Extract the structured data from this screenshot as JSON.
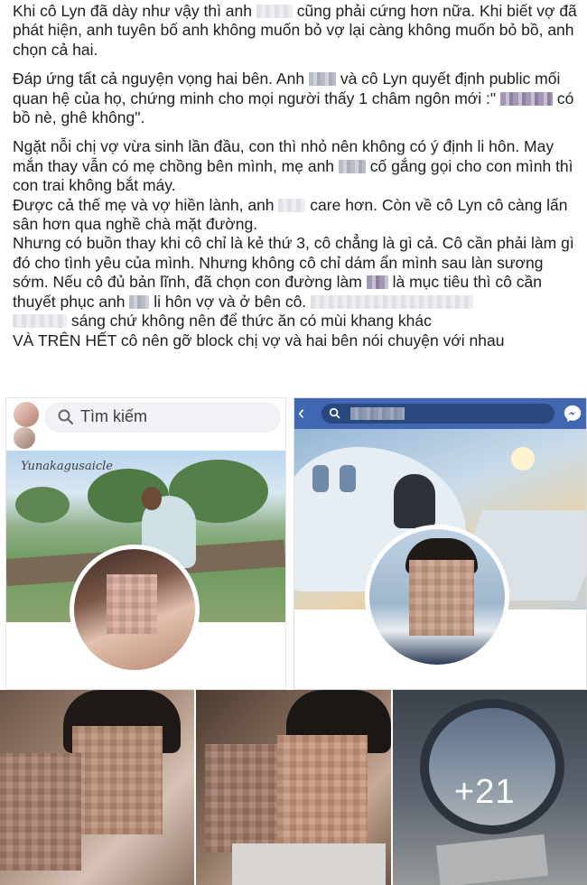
{
  "post": {
    "p1_a": "Khi cô Lyn đã dày như vậy thì anh",
    "p1_b": "cũng phải cứng hơn nữa. Khi biết vợ đã phát hiện, anh tuyên bố anh không muốn bỏ vợ lại càng không muốn bỏ bồ, anh chọn cả hai.",
    "p2_a": "Đáp ứng tất cả nguyện vọng hai bên. Anh",
    "p2_b": "và cô Lyn quyết định public mối quan hệ của họ, chứng minh cho mọi người thấy 1 châm ngôn mới :\"",
    "p2_c": "có bồ nè, ghê không\".",
    "p3_a": "Ngặt nỗi chị vợ vừa sinh lần đầu, con thì nhỏ nên không có ý định li hôn. May mắn thay vẫn có mẹ chồng bên mình, mẹ anh",
    "p3_b": "cố gắng gọi cho con mình thì con trai không bắt máy.",
    "p3_c": "Được cả thế mẹ và vợ hiền lành, anh",
    "p3_d": "care hơn. Còn về cô Lyn cô càng lấn sân hơn qua nghề chà mặt đường.",
    "p3_e": "Nhưng có buồn thay khi cô chỉ là kẻ thứ 3, cô chẳng là gì cả. Cô cần phải làm gì đó cho tình yêu của mình. Nhưng không cô chỉ dám ẩn mình sau làn sương sớm. Nếu cô đủ bản lĩnh, đã chọn con đường làm",
    "p3_f": "là mục tiêu thì cô cần thuyết phục anh",
    "p3_g": "li hôn vợ và ở bên cô.",
    "p3_h": "sáng chứ không nên để thức ăn có mùi khang khác",
    "p3_i": "VÀ TRÊN HẾT cô nên gỡ block chị vợ và hai bên nói chuyện với nhau"
  },
  "screenshot_left": {
    "search_placeholder": "Tìm kiếm",
    "search_icon": "search-icon",
    "signature": "Yunakagusaicle"
  },
  "screenshot_right": {
    "back_icon": "back-arrow-icon",
    "messenger_icon": "messenger-icon",
    "topbar_color": "#4267b2"
  },
  "photos": {
    "more_count": "+21"
  }
}
